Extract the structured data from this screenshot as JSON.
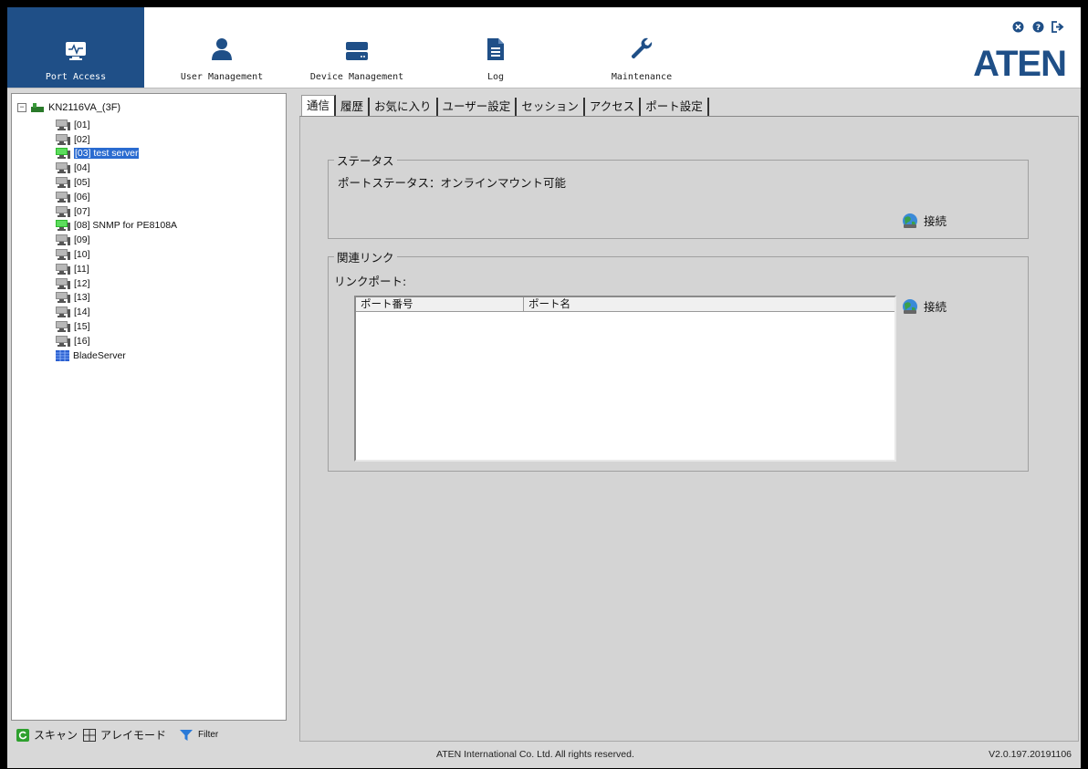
{
  "nav": {
    "items": [
      {
        "label": "Port Access",
        "icon": "monitor-pulse-icon",
        "active": true
      },
      {
        "label": "User Management",
        "icon": "user-icon"
      },
      {
        "label": "Device Management",
        "icon": "device-icon"
      },
      {
        "label": "Log",
        "icon": "document-icon"
      },
      {
        "label": "Maintenance",
        "icon": "wrench-icon"
      }
    ],
    "top_icons": [
      "close-circle-icon",
      "help-icon",
      "logout-icon"
    ],
    "logo": "ATEN",
    "accent_color": "#1f4f87"
  },
  "tree": {
    "root": "KN2116VA_(3F)",
    "items": [
      {
        "label": "[01]",
        "status": "offline"
      },
      {
        "label": "[02]",
        "status": "offline"
      },
      {
        "label": "[03] test server",
        "status": "online",
        "selected": true
      },
      {
        "label": "[04]",
        "status": "offline"
      },
      {
        "label": "[05]",
        "status": "offline"
      },
      {
        "label": "[06]",
        "status": "offline"
      },
      {
        "label": "[07]",
        "status": "offline"
      },
      {
        "label": "[08] SNMP for PE8108A",
        "status": "online"
      },
      {
        "label": "[09]",
        "status": "offline"
      },
      {
        "label": "[10]",
        "status": "offline"
      },
      {
        "label": "[11]",
        "status": "offline"
      },
      {
        "label": "[12]",
        "status": "offline"
      },
      {
        "label": "[13]",
        "status": "offline"
      },
      {
        "label": "[14]",
        "status": "offline"
      },
      {
        "label": "[15]",
        "status": "offline"
      },
      {
        "label": "[16]",
        "status": "offline"
      },
      {
        "label": "BladeServer",
        "status": "blade"
      }
    ]
  },
  "bottom_bar": {
    "scan": "スキャン",
    "array_mode": "アレイモード",
    "filter": "Filter"
  },
  "tabs": [
    {
      "label": "通信",
      "active": true
    },
    {
      "label": "履歴"
    },
    {
      "label": "お気に入り"
    },
    {
      "label": "ユーザー設定"
    },
    {
      "label": "セッション"
    },
    {
      "label": "アクセス"
    },
    {
      "label": "ポート設定"
    }
  ],
  "status_group": {
    "title": "ステータス",
    "text": "ポートステータス：オンラインマウント可能",
    "connect_label": "接続"
  },
  "link_group": {
    "title": "関連リンク",
    "link_port_label": "リンクポート:",
    "columns": [
      "ポート番号",
      "ポート名"
    ],
    "rows": [],
    "connect_label": "接続"
  },
  "footer": {
    "copyright": "ATEN International Co. Ltd. All rights reserved.",
    "version": "V2.0.197.20191106"
  }
}
